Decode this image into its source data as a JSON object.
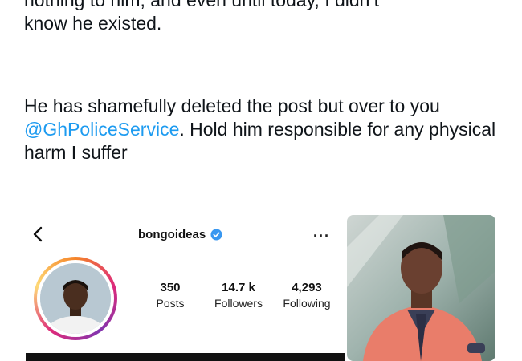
{
  "tweet": {
    "para1_line1": "nothing to him, and even until today, I didn’t",
    "para1_line2": "know he existed.",
    "para2_start": "He has shamefully deleted the post but over to you ",
    "para2_mention": "@GhPoliceService",
    "para2_end": ". Hold him responsible for any physical harm I suffer",
    "mention_color": "#1d9bf0"
  },
  "profile_card": {
    "username": "bongoideas",
    "verified": true,
    "icons": {
      "back": "chevron-left-icon",
      "verified": "verified-badge-icon",
      "more": "more-horizontal-icon"
    },
    "more_glyph": "···",
    "stats": [
      {
        "value": "350",
        "label": "Posts"
      },
      {
        "value": "14.7 k",
        "label": "Followers"
      },
      {
        "value": "4,293",
        "label": "Following"
      }
    ],
    "story_ring_colors": [
      "#f58529",
      "#dd2a7b",
      "#8134af",
      "#feda77"
    ]
  }
}
